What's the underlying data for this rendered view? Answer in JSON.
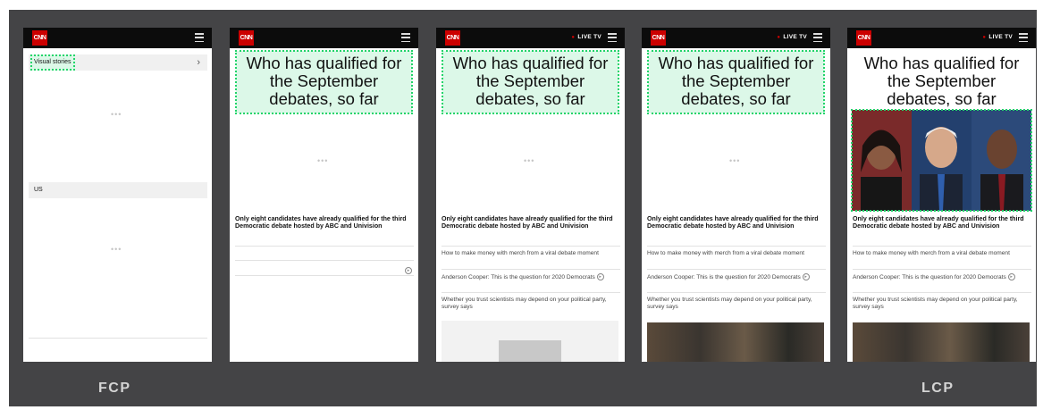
{
  "frames": [
    {
      "logo": "CNN",
      "menu_icon": "hamburger-menu-icon",
      "visual_stories": "Visual stories",
      "chevron_icon": "chevron-right-icon",
      "section_us": "US",
      "loading_1": "•••",
      "loading_2": "•••"
    },
    {
      "logo": "CNN",
      "menu_icon": "hamburger-menu-icon",
      "headline": "Who has qualified for the September debates, so far",
      "loading": "•••",
      "summary": "Only eight candidates have already qualified for the third Democratic debate hosted by ABC and Univision",
      "play_icon": "play-circle-icon"
    },
    {
      "logo": "CNN",
      "live_tv": "LIVE TV",
      "menu_icon": "hamburger-menu-icon",
      "headline": "Who has qualified for the September debates, so far",
      "loading": "•••",
      "summary": "Only eight candidates have already qualified for the third Democratic debate hosted by ABC and Univision",
      "link_1": "How to make money with merch from a viral debate moment",
      "link_2": "Anderson Cooper: This is the question for 2020 Democrats",
      "link_3": "Whether you trust scientists may depend on your political party, survey says"
    },
    {
      "logo": "CNN",
      "live_tv": "LIVE TV",
      "menu_icon": "hamburger-menu-icon",
      "headline": "Who has qualified for the September debates, so far",
      "loading": "•••",
      "summary": "Only eight candidates have already qualified for the third Democratic debate hosted by ABC and Univision",
      "link_1": "How to make money with merch from a viral debate moment",
      "link_2": "Anderson Cooper: This is the question for 2020 Democrats",
      "link_3": "Whether you trust scientists may depend on your political party, survey says"
    },
    {
      "logo": "CNN",
      "live_tv": "LIVE TV",
      "menu_icon": "hamburger-menu-icon",
      "headline": "Who has qualified for the September debates, so far",
      "summary": "Only eight candidates have already qualified for the third Democratic debate hosted by ABC and Univision",
      "link_1": "How to make money with merch from a viral debate moment",
      "link_2": "Anderson Cooper: This is the question for 2020 Democrats",
      "link_3": "Whether you trust scientists may depend on your political party, survey says"
    }
  ],
  "captions": {
    "first": "FCP",
    "last": "LCP"
  },
  "colors": {
    "highlight_fill": "#dcf8e8",
    "highlight_border": "#22d46a",
    "brand_red": "#cc0000",
    "stage_bg": "#444446"
  }
}
